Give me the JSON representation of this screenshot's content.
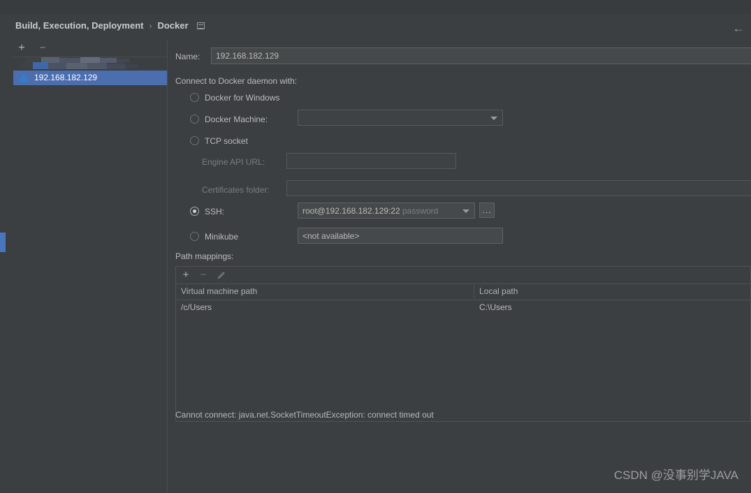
{
  "header": {
    "breadcrumb_root": "Build, Execution, Deployment",
    "breadcrumb_separator": "›",
    "breadcrumb_current": "Docker",
    "settings_icon": "panel-icon",
    "back_icon": "←"
  },
  "sidebar": {
    "add_label": "+",
    "remove_label": "−",
    "items": [
      {
        "label": "",
        "redacted": true
      },
      {
        "label": "192.168.182.129",
        "redacted": false,
        "selected": true,
        "icon": "docker-whale-icon"
      }
    ]
  },
  "form": {
    "name_label": "Name:",
    "name_value": "192.168.182.129",
    "connect_label": "Connect to Docker daemon with:",
    "options": [
      {
        "label": "Docker for Windows",
        "selected": false
      },
      {
        "label": "Docker Machine:",
        "selected": false
      },
      {
        "label": "TCP socket",
        "selected": false
      },
      {
        "label": "SSH:",
        "selected": true
      },
      {
        "label": "Minikube",
        "selected": false
      }
    ],
    "docker_machine_value": "",
    "engine_api_label": "Engine API URL:",
    "engine_api_value": "",
    "certificates_label": "Certificates folder:",
    "certificates_value": "",
    "ssh_value": "root@192.168.182.129:22",
    "ssh_value_suffix": "password",
    "browse_label": "...",
    "minikube_value": "<not available>"
  },
  "path_mappings": {
    "title": "Path mappings:",
    "toolbar": {
      "add": "+",
      "remove": "−",
      "edit": "edit-pencil-icon"
    },
    "columns": [
      "Virtual machine path",
      "Local path"
    ],
    "rows": [
      {
        "vm_path": "/c/Users",
        "local_path": "C:\\Users"
      }
    ]
  },
  "status": {
    "error": "Cannot connect: java.net.SocketTimeoutException: connect timed out"
  },
  "watermark": "CSDN @没事别学JAVA",
  "colors": {
    "background": "#3c3f41",
    "selection": "#4b6eaf",
    "accent": "#4a76bd",
    "text": "#bbbbbb",
    "text_dim": "#7a7d80",
    "border": "#5e6264"
  }
}
